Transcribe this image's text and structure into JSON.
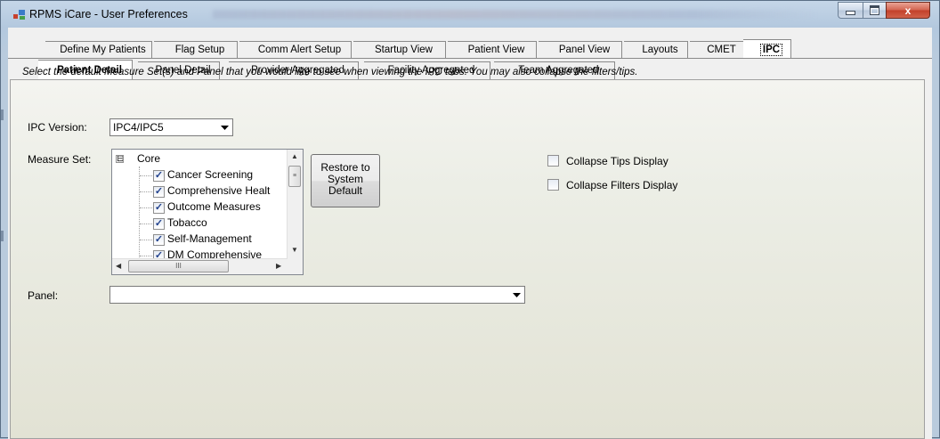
{
  "window": {
    "title": "RPMS iCare - User Preferences",
    "close_symbol": "x"
  },
  "outer_tabs": [
    {
      "label": "Define My Patients"
    },
    {
      "label": "Flag Setup"
    },
    {
      "label": "Comm Alert Setup"
    },
    {
      "label": "Startup View"
    },
    {
      "label": "Patient View"
    },
    {
      "label": "Panel View"
    },
    {
      "label": "Layouts"
    },
    {
      "label": "CMET"
    },
    {
      "label": "IPC",
      "selected": true
    }
  ],
  "inner_tabs": [
    {
      "label": "Patient Detail",
      "selected": true
    },
    {
      "label": "Panel Detail"
    },
    {
      "label": "Provider Aggregated"
    },
    {
      "label": "Facility Aggregated"
    },
    {
      "label": "Team Aggregated"
    }
  ],
  "content": {
    "instructions": "Select the default Measure Set(s) and Panel that you would like to see when viewing the IPC tabs. You may also collapse the filters/tips.",
    "ipc_version_label": "IPC Version:",
    "ipc_version_value": "IPC4/IPC5",
    "measure_set_label": "Measure Set:",
    "measure_tree": {
      "root": "Core",
      "expander": "⊟",
      "items": [
        {
          "label": "Cancer Screening",
          "checked": true
        },
        {
          "label": "Comprehensive Healt",
          "checked": true
        },
        {
          "label": "Outcome Measures",
          "checked": true
        },
        {
          "label": "Tobacco",
          "checked": true
        },
        {
          "label": "Self-Management",
          "checked": true
        },
        {
          "label": "DM Comprehensive",
          "checked": true
        }
      ]
    },
    "restore_button": {
      "line1": "Restore to",
      "line2": "System",
      "line3": "Default"
    },
    "collapse_tips": {
      "label": "Collapse Tips Display",
      "checked": false
    },
    "collapse_filters": {
      "label": "Collapse Filters Display",
      "checked": false
    },
    "panel_label": "Panel:",
    "panel_value": ""
  },
  "icons": {
    "app": "window-app-icon",
    "dropdown": "chevron-down-icon",
    "scroll_up": "▲",
    "scroll_down": "▼",
    "scroll_left": "◀",
    "scroll_right": "▶",
    "grip_v": "≡",
    "grip_h": "III",
    "check": "✓"
  },
  "colors": {
    "accent_check": "#21418d",
    "close_button": "#c2402a"
  }
}
